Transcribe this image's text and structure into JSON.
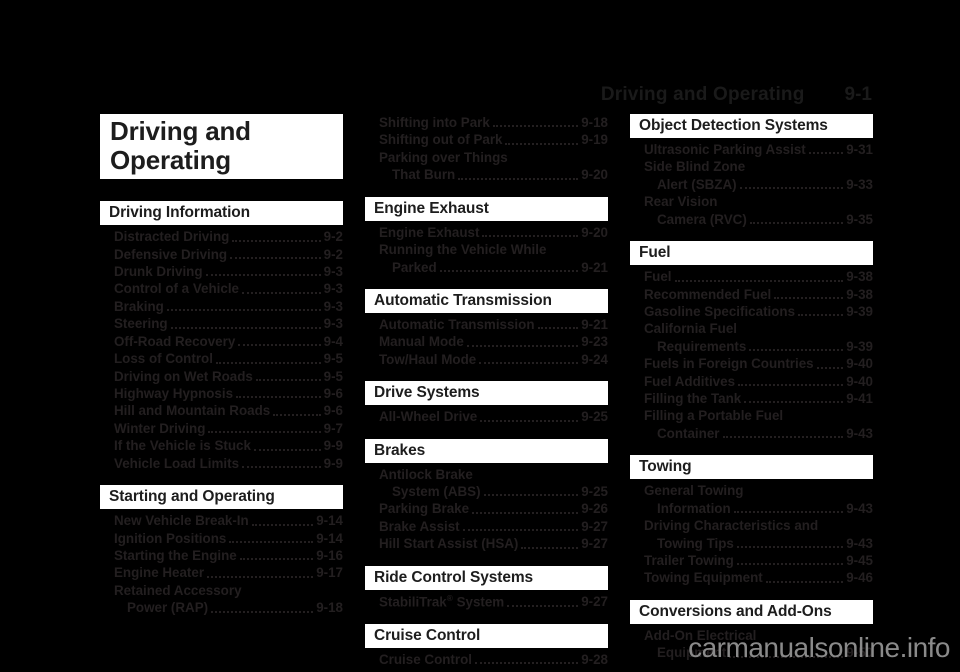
{
  "header": {
    "title": "Driving and Operating",
    "page_number": "9-1"
  },
  "chapter_title": {
    "line1": "Driving and",
    "line2": "Operating"
  },
  "watermark": "carmanualsonline.info",
  "columns": [
    {
      "sections": [
        {
          "heading": "Driving Information",
          "entries": [
            {
              "label": "Distracted Driving",
              "page": "9-2"
            },
            {
              "label": "Defensive Driving",
              "page": "9-2"
            },
            {
              "label": "Drunk Driving",
              "page": "9-3"
            },
            {
              "label": "Control of a Vehicle",
              "page": "9-3"
            },
            {
              "label": "Braking",
              "page": "9-3"
            },
            {
              "label": "Steering",
              "page": "9-3"
            },
            {
              "label": "Off-Road Recovery",
              "page": "9-4"
            },
            {
              "label": "Loss of Control",
              "page": "9-5"
            },
            {
              "label": "Driving on Wet Roads",
              "page": "9-5"
            },
            {
              "label": "Highway Hypnosis",
              "page": "9-6"
            },
            {
              "label": "Hill and Mountain Roads",
              "page": "9-6"
            },
            {
              "label": "Winter Driving",
              "page": "9-7"
            },
            {
              "label": "If the Vehicle is Stuck",
              "page": "9-9"
            },
            {
              "label": "Vehicle Load Limits",
              "page": "9-9"
            }
          ]
        },
        {
          "heading": "Starting and Operating",
          "entries": [
            {
              "label": "New Vehicle Break-In",
              "page": "9-14"
            },
            {
              "label": "Ignition Positions",
              "page": "9-14"
            },
            {
              "label": "Starting the Engine",
              "page": "9-16"
            },
            {
              "label": "Engine Heater",
              "page": "9-17"
            },
            {
              "label": "Retained Accessory",
              "label2": "Power (RAP)",
              "page": "9-18"
            }
          ]
        }
      ]
    },
    {
      "sections": [
        {
          "heading": null,
          "entries": [
            {
              "label": "Shifting into Park",
              "page": "9-18"
            },
            {
              "label": "Shifting out of Park",
              "page": "9-19"
            },
            {
              "label": "Parking over Things",
              "label2": "That Burn",
              "page": "9-20"
            }
          ]
        },
        {
          "heading": "Engine Exhaust",
          "entries": [
            {
              "label": "Engine Exhaust",
              "page": "9-20"
            },
            {
              "label": "Running the Vehicle While",
              "label2": "Parked",
              "page": "9-21"
            }
          ]
        },
        {
          "heading": "Automatic Transmission",
          "entries": [
            {
              "label": "Automatic Transmission",
              "page": "9-21"
            },
            {
              "label": "Manual Mode",
              "page": "9-23"
            },
            {
              "label": "Tow/Haul Mode",
              "page": "9-24"
            }
          ]
        },
        {
          "heading": "Drive Systems",
          "entries": [
            {
              "label": "All-Wheel Drive",
              "page": "9-25"
            }
          ]
        },
        {
          "heading": "Brakes",
          "entries": [
            {
              "label": "Antilock Brake",
              "label2": "System (ABS)",
              "page": "9-25"
            },
            {
              "label": "Parking Brake",
              "page": "9-26"
            },
            {
              "label": "Brake Assist",
              "page": "9-27"
            },
            {
              "label": "Hill Start Assist (HSA)",
              "page": "9-27"
            }
          ]
        },
        {
          "heading": "Ride Control Systems",
          "entries": [
            {
              "label": "StabiliTrak® System",
              "page": "9-27"
            }
          ]
        },
        {
          "heading": "Cruise Control",
          "entries": [
            {
              "label": "Cruise Control",
              "page": "9-28"
            }
          ]
        }
      ]
    },
    {
      "sections": [
        {
          "heading": "Object Detection Systems",
          "entries": [
            {
              "label": "Ultrasonic Parking Assist",
              "page": "9-31"
            },
            {
              "label": "Side Blind Zone",
              "label2": "Alert (SBZA)",
              "page": "9-33"
            },
            {
              "label": "Rear Vision",
              "label2": "Camera (RVC)",
              "page": "9-35"
            }
          ]
        },
        {
          "heading": "Fuel",
          "entries": [
            {
              "label": "Fuel",
              "page": "9-38"
            },
            {
              "label": "Recommended Fuel",
              "page": "9-38"
            },
            {
              "label": "Gasoline Specifications",
              "page": "9-39"
            },
            {
              "label": "California Fuel",
              "label2": "Requirements",
              "page": "9-39"
            },
            {
              "label": "Fuels in Foreign Countries",
              "page": "9-40"
            },
            {
              "label": "Fuel Additives",
              "page": "9-40"
            },
            {
              "label": "Filling the Tank",
              "page": "9-41"
            },
            {
              "label": "Filling a Portable Fuel",
              "label2": "Container",
              "page": "9-43"
            }
          ]
        },
        {
          "heading": "Towing",
          "entries": [
            {
              "label": "General Towing",
              "label2": "Information",
              "page": "9-43"
            },
            {
              "label": "Driving Characteristics and",
              "label2": "Towing Tips",
              "page": "9-43"
            },
            {
              "label": "Trailer Towing",
              "page": "9-45"
            },
            {
              "label": "Towing Equipment",
              "page": "9-46"
            }
          ]
        },
        {
          "heading": "Conversions and Add-Ons",
          "entries": [
            {
              "label": "Add-On Electrical",
              "label2": "Equipment",
              "page": "9-50"
            }
          ]
        }
      ]
    }
  ]
}
